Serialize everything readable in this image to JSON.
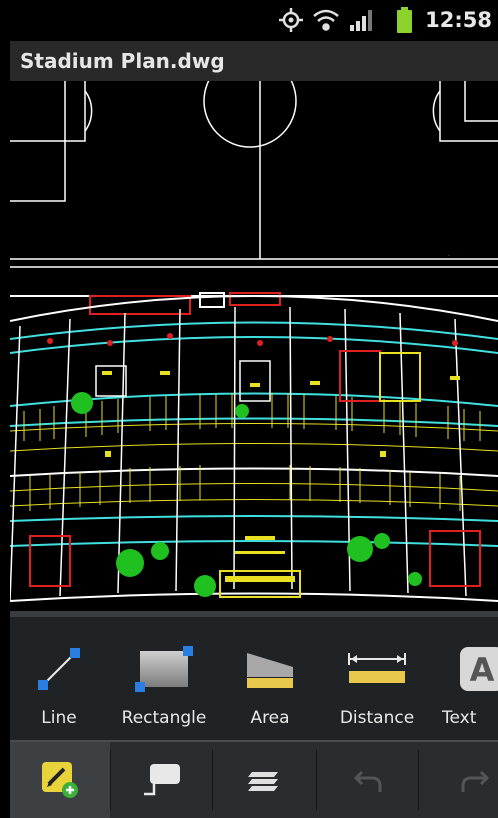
{
  "status_bar": {
    "time": "12:58",
    "icons": [
      "gps-icon",
      "wifi-icon",
      "signal-icon",
      "battery-icon"
    ]
  },
  "document": {
    "title": "Stadium Plan.dwg"
  },
  "tools": [
    {
      "name": "line",
      "label": "Line",
      "icon": "line-tool-icon"
    },
    {
      "name": "rectangle",
      "label": "Rectangle",
      "icon": "rectangle-tool-icon"
    },
    {
      "name": "area",
      "label": "Area",
      "icon": "area-tool-icon"
    },
    {
      "name": "distance",
      "label": "Distance",
      "icon": "distance-tool-icon"
    },
    {
      "name": "text",
      "label": "Text",
      "icon": "text-tool-icon"
    }
  ],
  "bottom_toolbar": {
    "items": [
      "edit-add-icon",
      "comment-icon",
      "layers-icon",
      "undo-icon",
      "redo-icon"
    ],
    "active": "edit-add-icon"
  },
  "colors": {
    "cad_white": "#ffffff",
    "cad_cyan": "#40e0e0",
    "cad_yellow": "#e8e020",
    "cad_red": "#e02020",
    "cad_green": "#20c020",
    "accent_blue": "#2a7de1",
    "edit_yellow": "#e8d43a"
  }
}
